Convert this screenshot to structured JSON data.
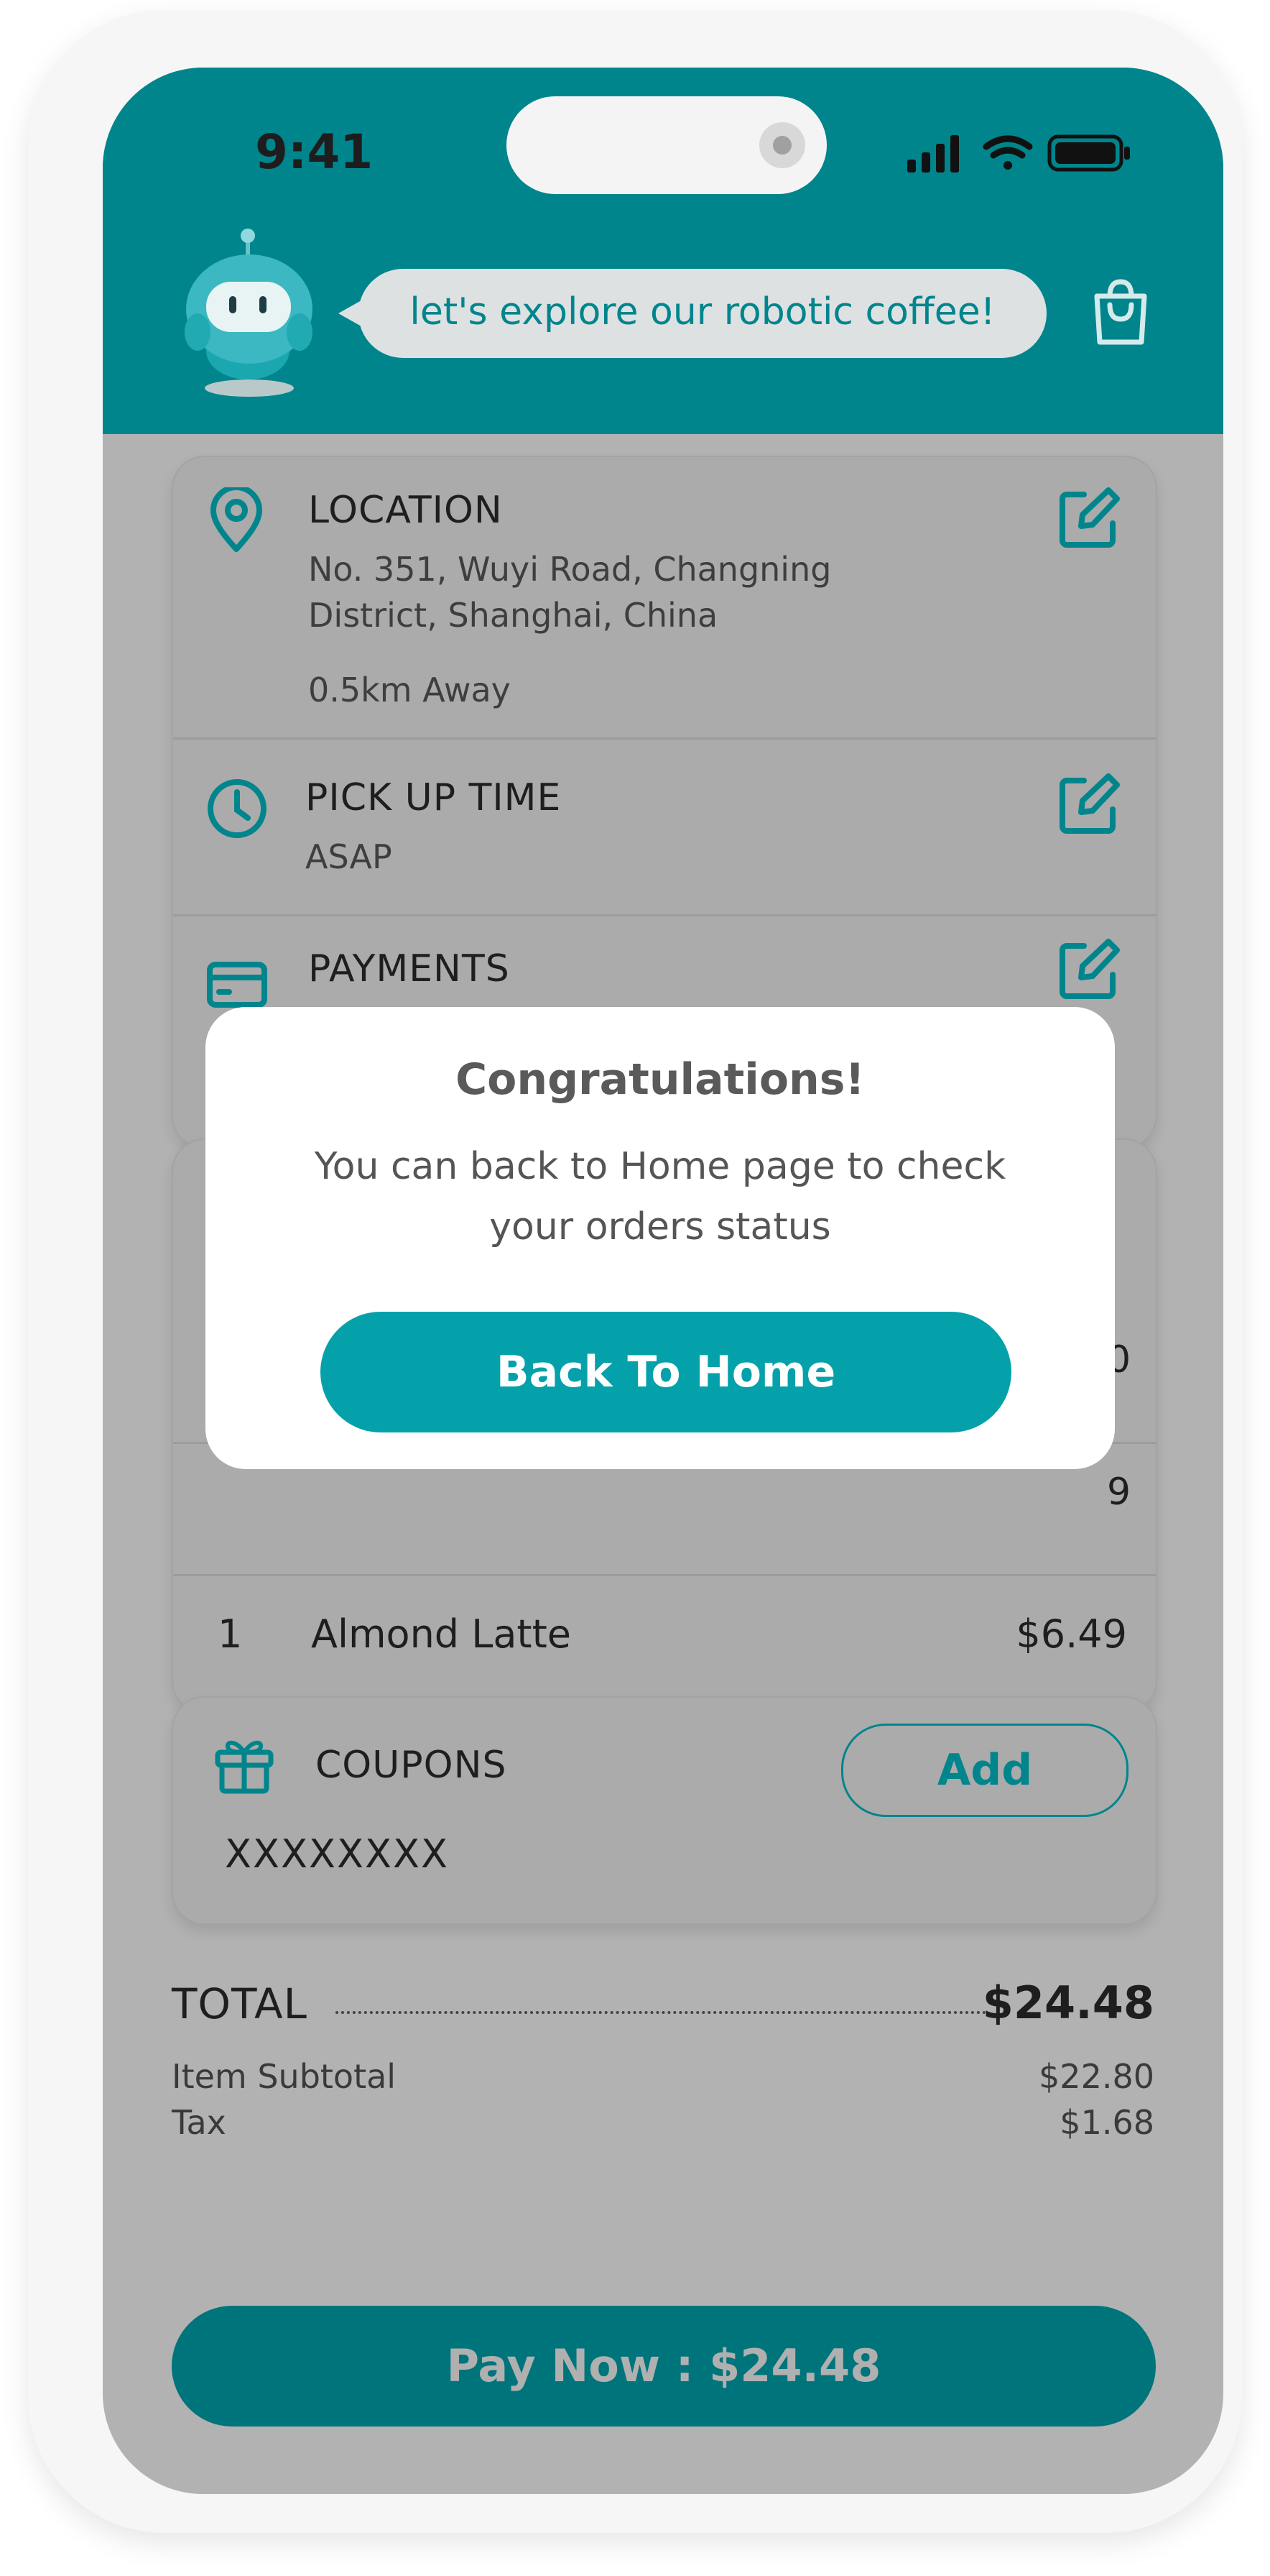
{
  "status_bar": {
    "time": "9:41"
  },
  "header": {
    "bubble_text": "let's explore our robotic coffee!"
  },
  "location": {
    "title": "LOCATION",
    "address_line1": "No. 351, Wuyi Road, Changning",
    "address_line2": "District, Shanghai, China",
    "distance": "0.5km Away"
  },
  "pickup": {
    "title": "PICK UP TIME",
    "value": "ASAP"
  },
  "payments": {
    "title": "PAYMENTS"
  },
  "order": {
    "items": [
      {
        "qty": "1",
        "name": "Almond Latte",
        "price": "$6.49"
      }
    ],
    "partial_prices": [
      "0",
      "9"
    ]
  },
  "coupons": {
    "title": "COUPONS",
    "code": "XXXXXXXX",
    "add_label": "Add"
  },
  "totals": {
    "total_label": "TOTAL",
    "total_value": "$24.48",
    "subtotal_label": "Item Subtotal",
    "subtotal_value": "$22.80",
    "tax_label": "Tax",
    "tax_value": "$1.68"
  },
  "pay_now_label": "Pay Now : $24.48",
  "modal": {
    "title": "Congratulations!",
    "message": "You can back to Home page to check your orders status",
    "button_label": "Back To Home"
  },
  "colors": {
    "primary": "#00858d",
    "button_teal": "#04a1ab",
    "overlay_gray": "#b2b2b2"
  }
}
